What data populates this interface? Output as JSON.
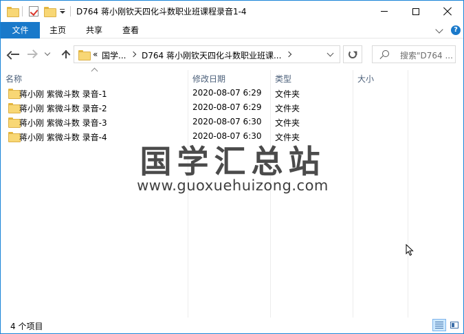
{
  "window": {
    "title": "D764 蒋小刚钦天四化斗数职业班课程录音1-4"
  },
  "ribbon": {
    "tabs": [
      {
        "label": "文件"
      },
      {
        "label": "主页"
      },
      {
        "label": "共享"
      },
      {
        "label": "查看"
      }
    ],
    "help": "?"
  },
  "address": {
    "overflow": "«",
    "crumbs": [
      "国学...",
      "D764 蒋小刚钦天四化斗数职业班课..."
    ]
  },
  "search": {
    "placeholder": "搜索\"D764 ..."
  },
  "columns": {
    "name": "名称",
    "date": "修改日期",
    "type": "类型",
    "size": "大小"
  },
  "files": [
    {
      "name": "蒋小刚 紫微斗数 录音-1",
      "date": "2020-08-07 6:29",
      "type": "文件夹",
      "size": ""
    },
    {
      "name": "蒋小刚 紫微斗数 录音-2",
      "date": "2020-08-07 6:29",
      "type": "文件夹",
      "size": ""
    },
    {
      "name": "蒋小刚 紫微斗数 录音-3",
      "date": "2020-08-07 6:30",
      "type": "文件夹",
      "size": ""
    },
    {
      "name": "蒋小刚 紫微斗数 录音-4",
      "date": "2020-08-07 6:30",
      "type": "文件夹",
      "size": ""
    }
  ],
  "watermark": {
    "title": "国学汇总站",
    "url": "www.guoxuehuizong.com"
  },
  "status": {
    "count": "4 个项目"
  },
  "colors": {
    "accent": "#1979ca",
    "folder": "#f8d775",
    "header_text": "#4c607a"
  }
}
